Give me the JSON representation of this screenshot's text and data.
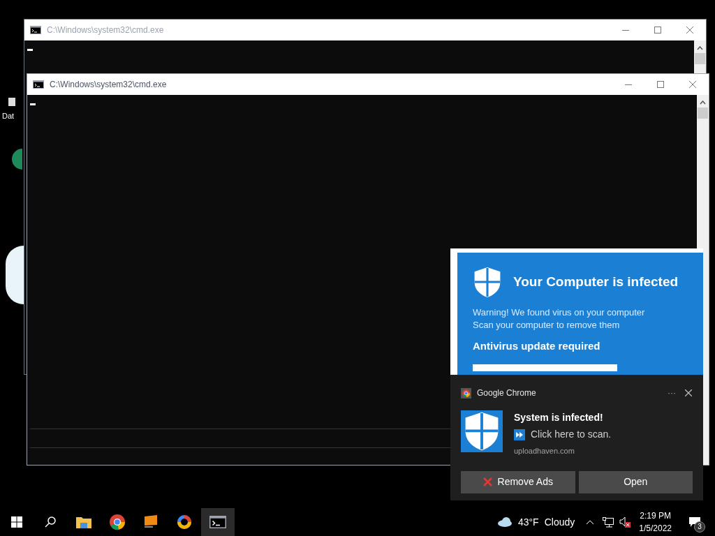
{
  "desktop": {
    "icon_label": "Dat"
  },
  "windows": [
    {
      "title": "C:\\Windows\\system32\\cmd.exe",
      "active": false
    },
    {
      "title": "C:\\Windows\\system32\\cmd.exe",
      "active": true
    }
  ],
  "popup": {
    "title": "Your Computer is infected",
    "lines": [
      "Warning! We found virus on your computer",
      "Scan your computer to remove them"
    ],
    "subtitle": "Antivirus update required"
  },
  "toast": {
    "app": "Google Chrome",
    "more": "···",
    "title": "System is infected!",
    "body": "Click here to scan.",
    "source": "uploadhaven.com",
    "buttons": [
      {
        "label": "Remove Ads",
        "kind": "remove"
      },
      {
        "label": "Open",
        "kind": "plain"
      }
    ]
  },
  "taskbar": {
    "apps": [
      {
        "kind": "start",
        "selected": false
      },
      {
        "kind": "search",
        "selected": false
      },
      {
        "kind": "folder",
        "selected": false
      },
      {
        "kind": "chrome",
        "selected": false
      },
      {
        "kind": "monitor",
        "selected": false
      },
      {
        "kind": "ring",
        "selected": false
      },
      {
        "kind": "cmd",
        "selected": true
      }
    ],
    "weather": {
      "temp": "43°F",
      "condition": "Cloudy"
    },
    "time": "2:19 PM",
    "date": "1/5/2022",
    "notifications": "3"
  }
}
